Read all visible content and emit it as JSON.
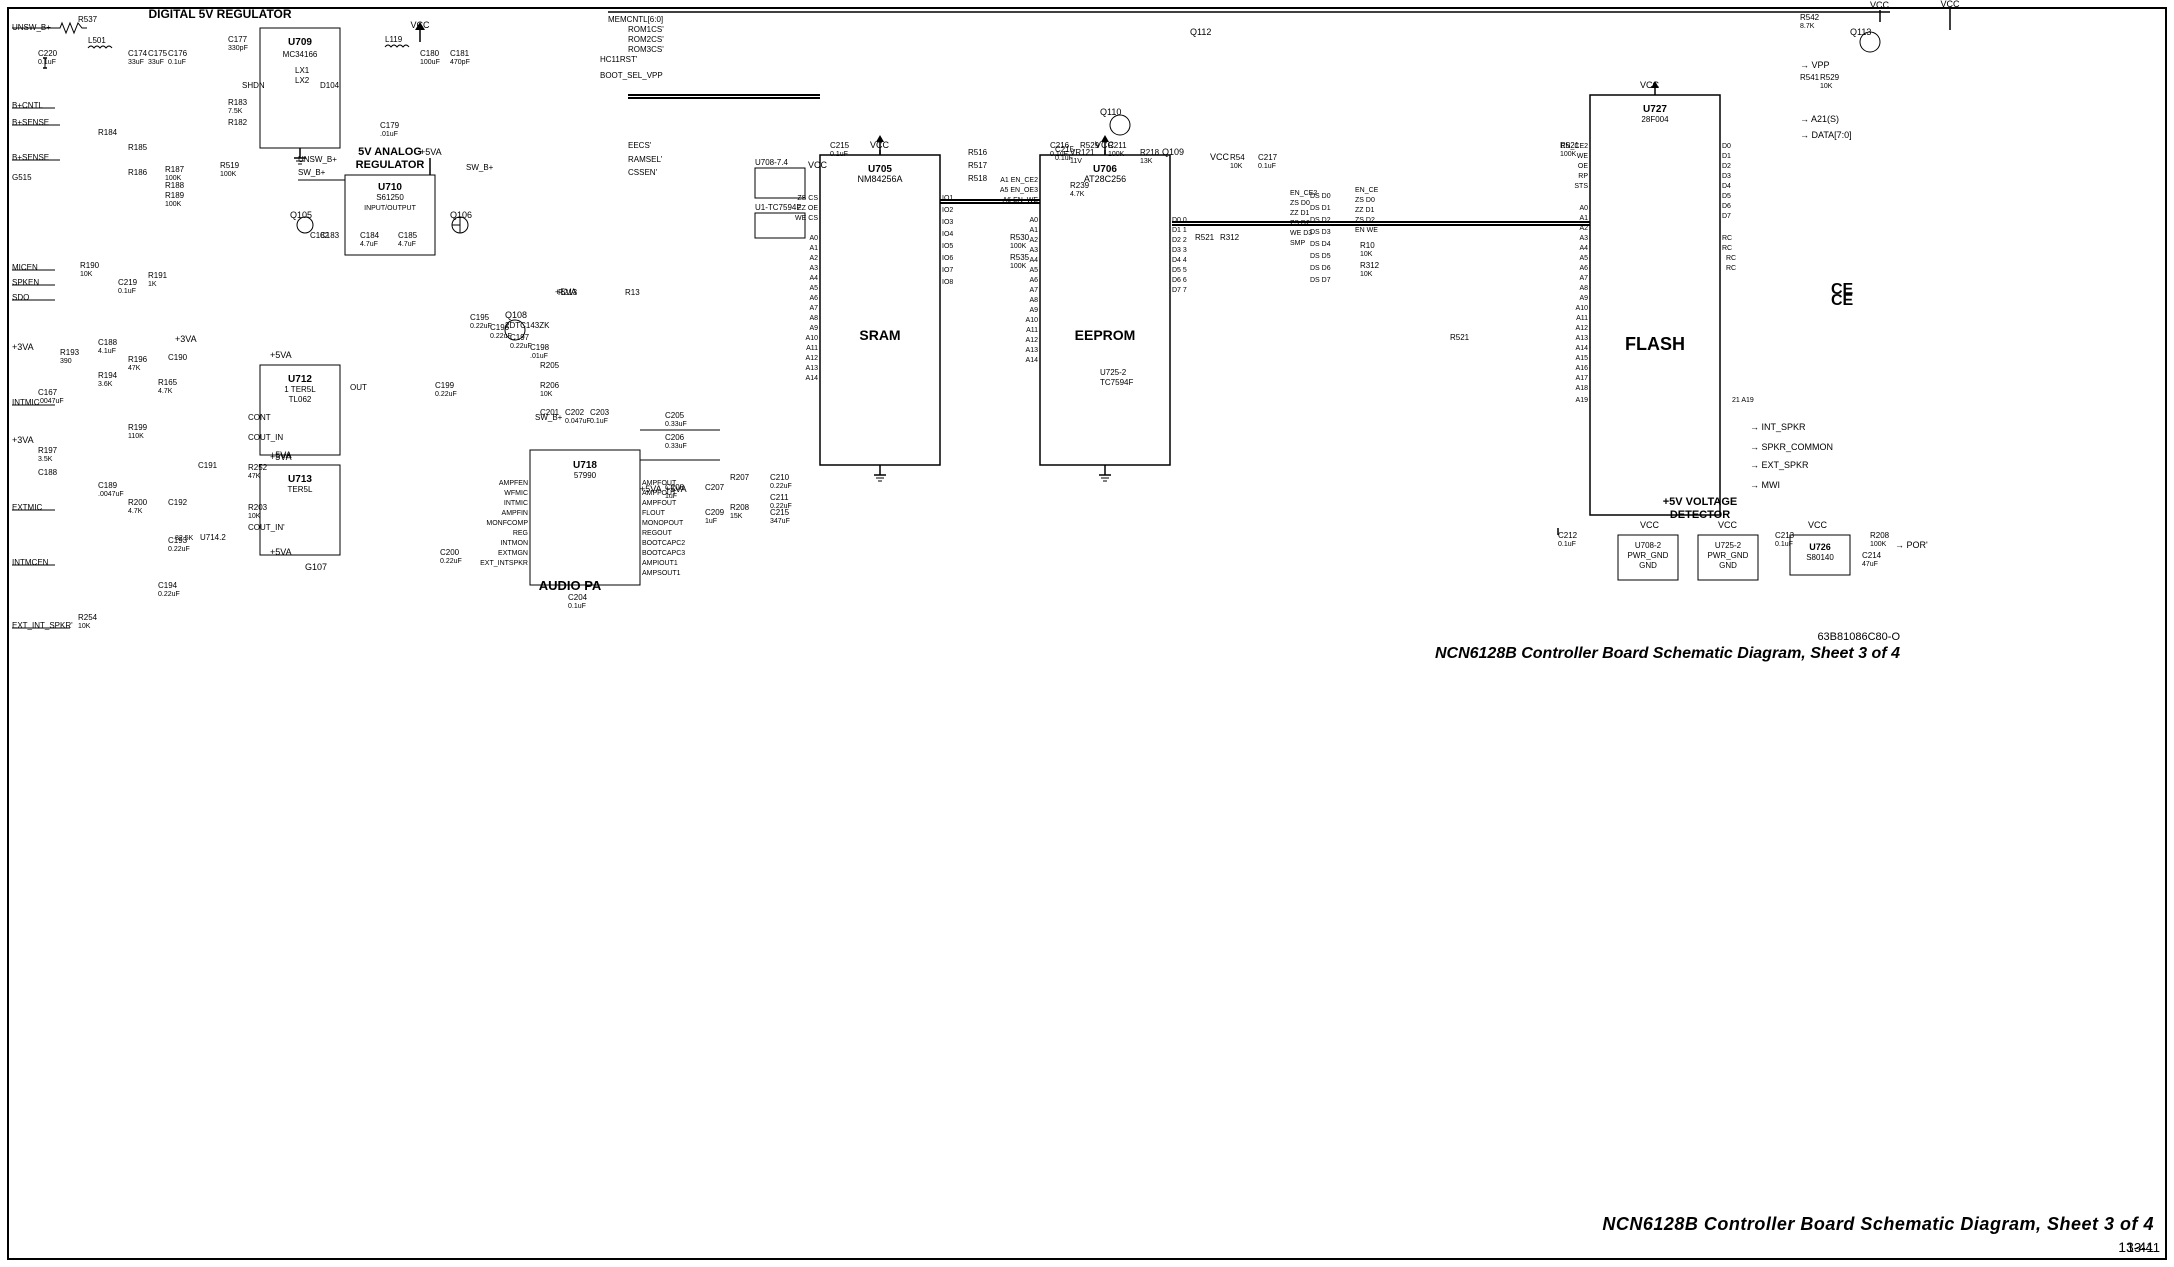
{
  "document": {
    "title": "NCN6128B Controller Board Schematic Diagram, Sheet 3 of 4",
    "sheet": "Sheet 3 of 4",
    "page_number": "13-41",
    "doc_ref": "63B81086C80-O"
  },
  "sections": {
    "digital_regulator": {
      "label": "DIGITAL 5V REGULATOR",
      "ic": "U709"
    },
    "analog_regulator": {
      "label": "5V ANALOG REGULATOR",
      "ic": "U710"
    },
    "audio_pa": {
      "label": "AUDIO PA"
    },
    "voltage_detector": {
      "label": "+5V VOLTAGE DETECTOR"
    }
  },
  "components": {
    "ce_label": "CE",
    "ics": [
      "U705",
      "U706",
      "U709",
      "U710",
      "U712",
      "U713",
      "U718",
      "U726",
      "U727"
    ],
    "labels": {
      "sram": "SRAM",
      "eeprom": "EEPROM",
      "flash": "FLASH"
    }
  },
  "colors": {
    "background": "#ffffff",
    "line": "#000000",
    "text": "#000000",
    "border": "#000000"
  }
}
